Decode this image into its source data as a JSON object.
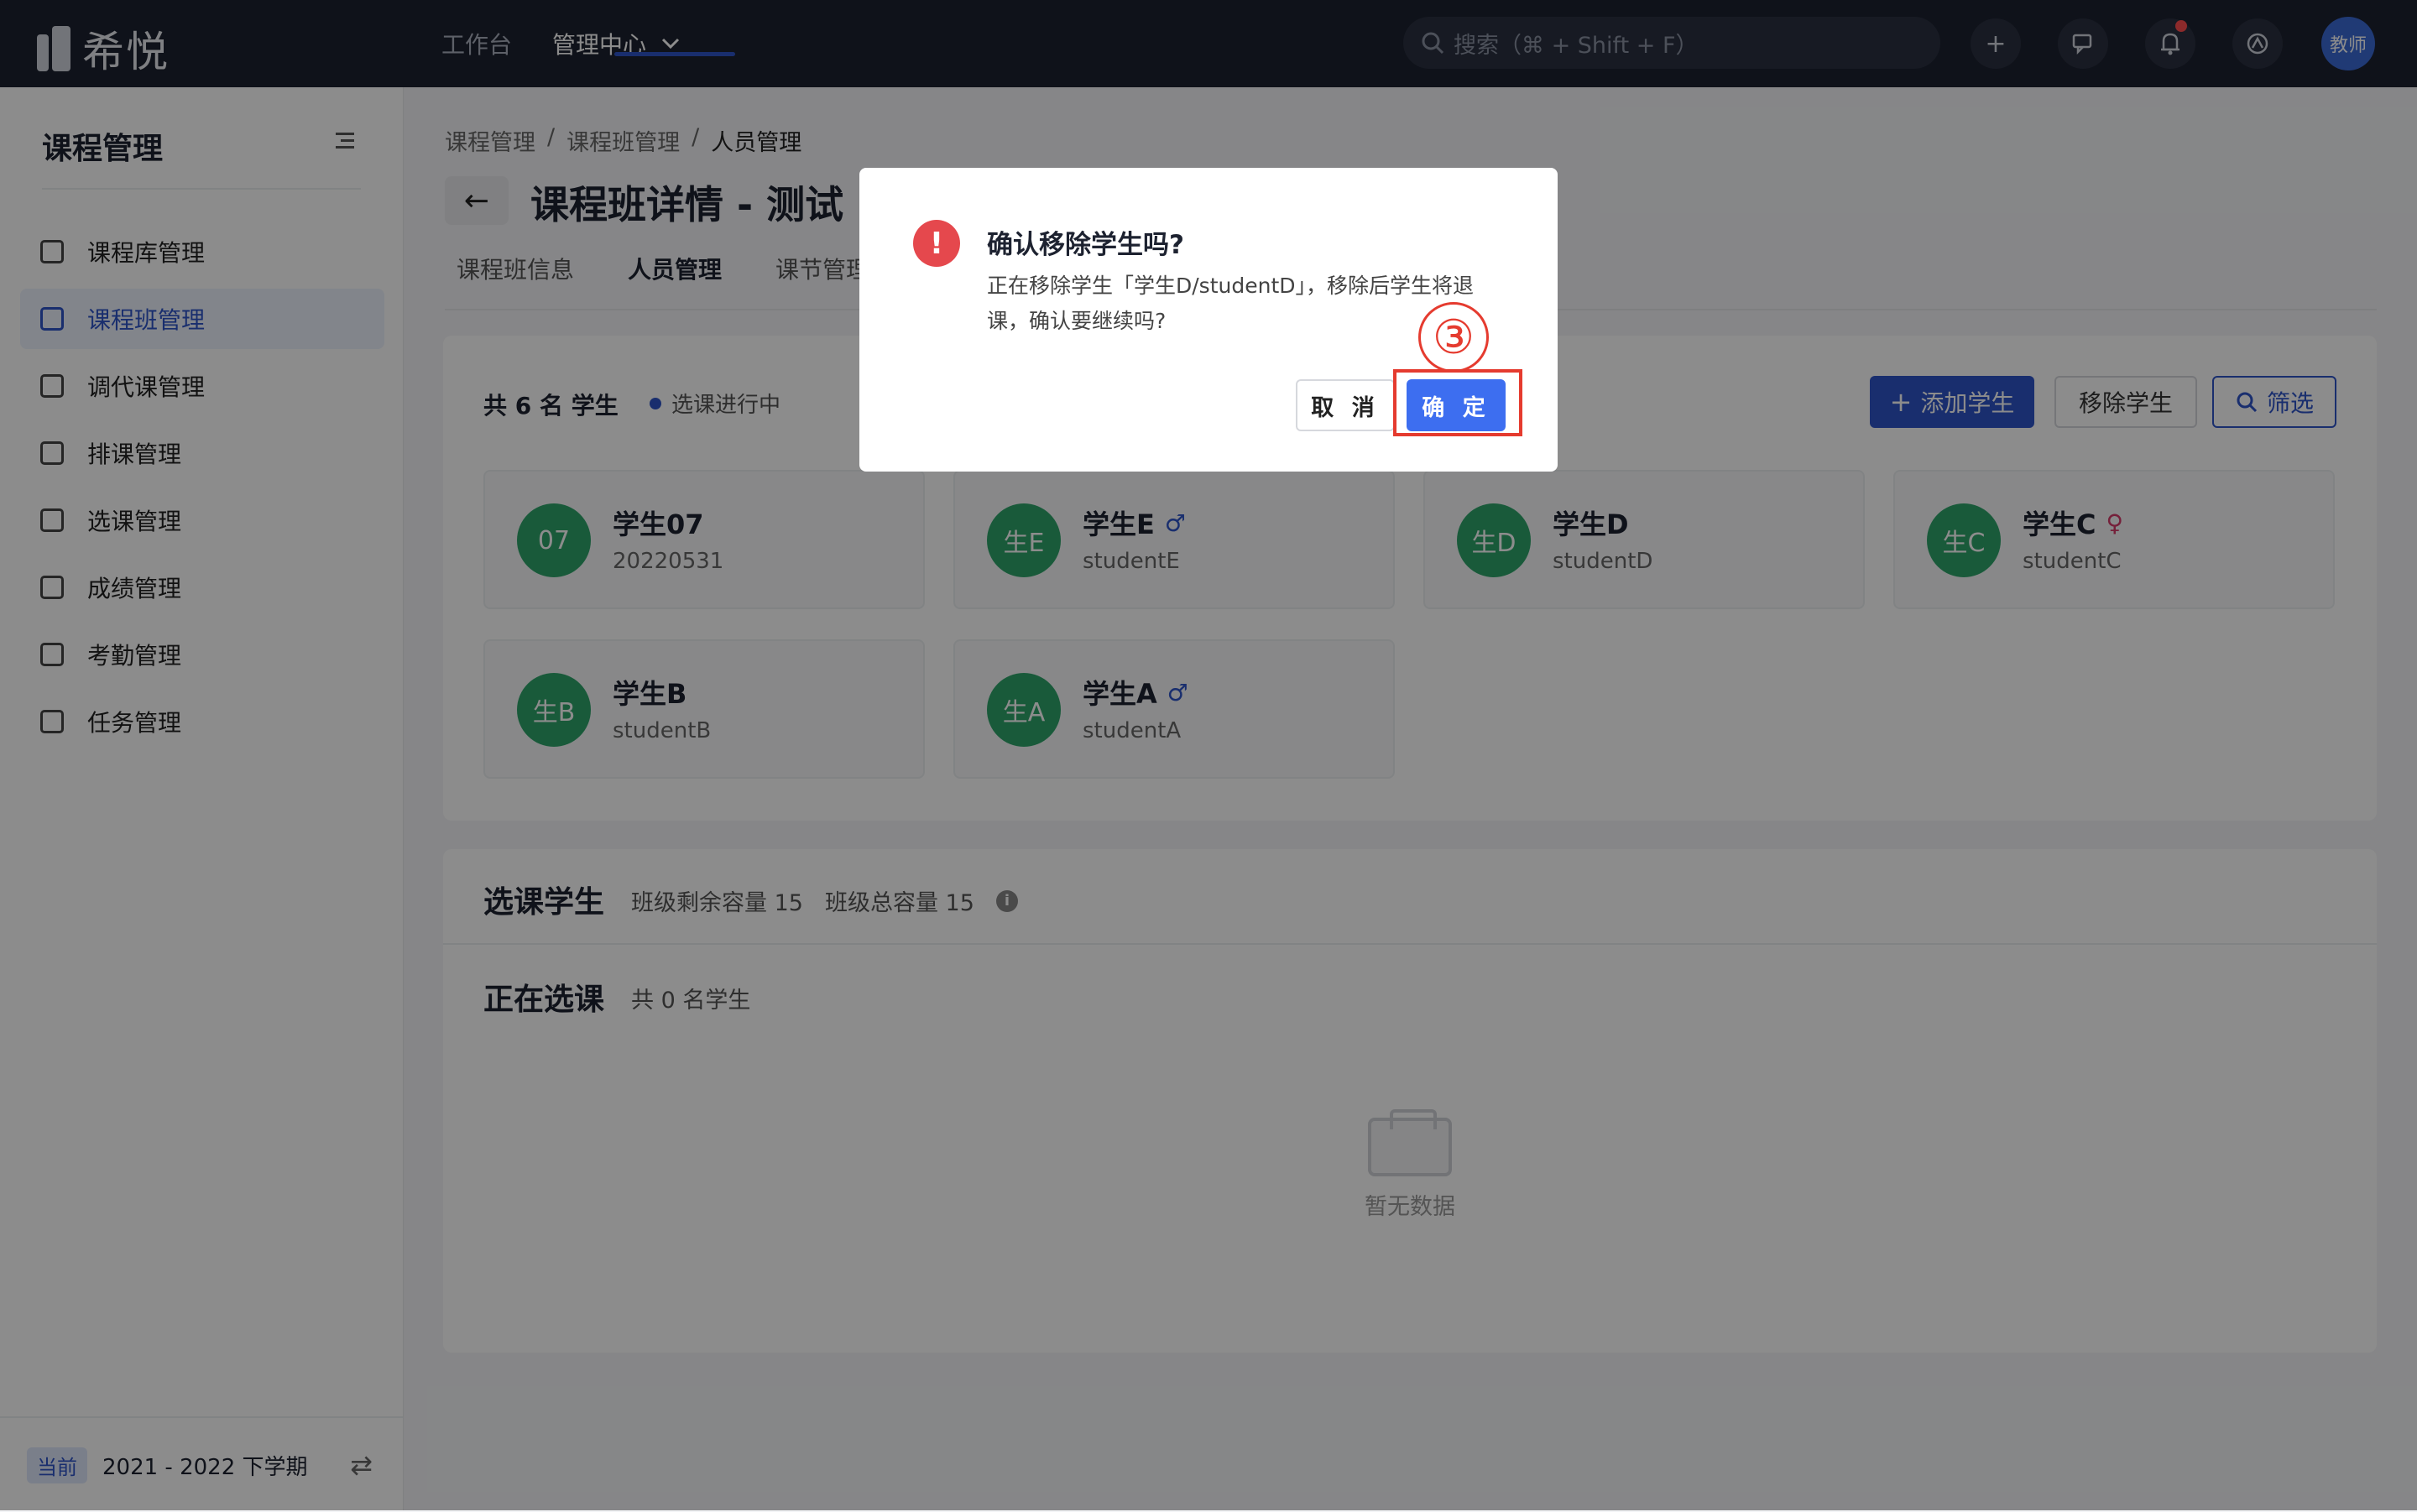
{
  "app": {
    "logo_text": "希悦"
  },
  "topnav": {
    "workbench": "工作台",
    "admin_center": "管理中心"
  },
  "search": {
    "placeholder": "搜索（⌘ + Shift + F）"
  },
  "user": {
    "avatar_label": "教师"
  },
  "sidebar": {
    "title": "课程管理",
    "items": [
      {
        "label": "课程库管理"
      },
      {
        "label": "课程班管理"
      },
      {
        "label": "调代课管理"
      },
      {
        "label": "排课管理"
      },
      {
        "label": "选课管理"
      },
      {
        "label": "成绩管理"
      },
      {
        "label": "考勤管理"
      },
      {
        "label": "任务管理"
      }
    ],
    "footer": {
      "badge": "当前",
      "term": "2021 - 2022 下学期"
    }
  },
  "breadcrumb": [
    "课程管理",
    "课程班管理",
    "人员管理"
  ],
  "page": {
    "title": "课程班详情 - 测试"
  },
  "tabs": [
    "课程班信息",
    "人员管理",
    "课节管理"
  ],
  "students_card": {
    "count_label": "共 6 名 学生",
    "status": "选课进行中",
    "add_button": "添加学生",
    "remove_button": "移除学生",
    "filter_button": "筛选",
    "students": [
      {
        "avatar": "07",
        "name": "学生07",
        "id": "20220531",
        "gender": ""
      },
      {
        "avatar": "生E",
        "name": "学生E",
        "id": "studentE",
        "gender": "♂"
      },
      {
        "avatar": "生D",
        "name": "学生D",
        "id": "studentD",
        "gender": ""
      },
      {
        "avatar": "生C",
        "name": "学生C",
        "id": "studentC",
        "gender": "♀"
      },
      {
        "avatar": "生B",
        "name": "学生B",
        "id": "studentB",
        "gender": ""
      },
      {
        "avatar": "生A",
        "name": "学生A",
        "id": "studentA",
        "gender": "♂"
      }
    ]
  },
  "selection_card": {
    "title": "选课学生",
    "remaining": "班级剩余容量 15",
    "total": "班级总容量 15",
    "sub_title": "正在选课",
    "sub_count": "共 0 名学生",
    "empty_text": "暂无数据"
  },
  "modal": {
    "title": "确认移除学生吗?",
    "body": "正在移除学生「学生D/studentD」，移除后学生将退课，确认要继续吗?",
    "cancel": "取 消",
    "confirm": "确 定",
    "step_marker": "③"
  },
  "colors": {
    "accent": "#2e55c9",
    "topbar": "#1d2230",
    "danger": "#e5484d",
    "avatar": "#2fa46b"
  }
}
